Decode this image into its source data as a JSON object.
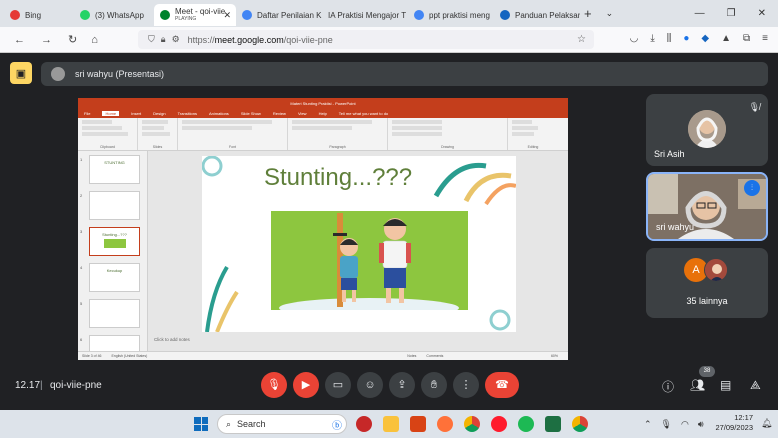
{
  "browser": {
    "tabs": [
      {
        "label": "Bing",
        "color": "#e53935"
      },
      {
        "label": "(3) WhatsApp",
        "color": "#25d366"
      },
      {
        "label": "Meet - qoi-viie",
        "sub": "PLAYING",
        "color": "#00832d"
      },
      {
        "label": "Daftar Penilaian K",
        "color": "#4285f4"
      },
      {
        "label": "IA Praktisi Mengajor T",
        "color": "#c0c0c0"
      },
      {
        "label": "ppt praktisi meng",
        "color": "#4285f4"
      },
      {
        "label": "Panduan Pelaksan",
        "color": "#1565c0"
      }
    ],
    "url_prefix": "https://",
    "url_domain": "meet.google.com",
    "url_path": "/qoi-viie-pne"
  },
  "presenter": {
    "label": "sri wahyu (Presentasi)"
  },
  "powerpoint": {
    "title": "Materi Stunting Praktisi - PowerPoint",
    "tabs": [
      "File",
      "Home",
      "Insert",
      "Design",
      "Transitions",
      "Animations",
      "Slide Show",
      "Review",
      "View",
      "Help",
      "Tell me what you want to do"
    ],
    "groups": [
      "Clipboard",
      "Slides",
      "Font",
      "Paragraph",
      "Drawing",
      "Editing"
    ],
    "thumbnails": [
      {
        "num": "1",
        "title": "STUNTING"
      },
      {
        "num": "2",
        "title": ""
      },
      {
        "num": "3",
        "title": "Stunting...???"
      },
      {
        "num": "4",
        "title": "Kecukup"
      },
      {
        "num": "5",
        "title": ""
      },
      {
        "num": "6",
        "title": ""
      }
    ],
    "slide_title": "Stunting...???",
    "notes_placeholder": "Click to add notes",
    "status_slide": "Slide 3 of 46",
    "status_lang": "English (United States)",
    "status_notes": "Notes",
    "status_comments": "Comments",
    "zoom": "60%"
  },
  "participants": [
    {
      "name": "Sri Asih"
    },
    {
      "name": "sri wahyu"
    },
    {
      "name": "35 lainnya",
      "initial": "A"
    }
  ],
  "meeting": {
    "time": "12.17",
    "separator": "|",
    "code": "qoi-viie-pne",
    "participant_count": "38"
  },
  "taskbar": {
    "search_label": "Search",
    "time": "12:17",
    "date": "27/09/2023"
  },
  "colors": {
    "meet_bg": "#202124",
    "end_call": "#ea4335",
    "ppt_red": "#c43e1c",
    "slide_title": "#5f7f3a"
  }
}
